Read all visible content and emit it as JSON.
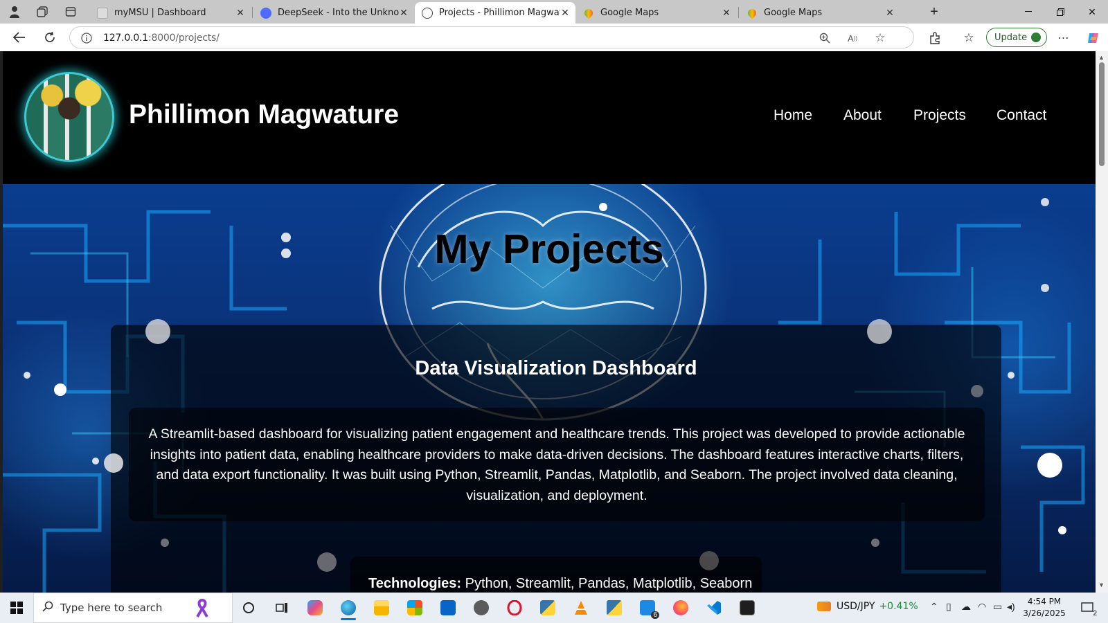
{
  "browser": {
    "tabs": [
      {
        "title": "myMSU | Dashboard",
        "favicon_color": "#d8d8d8",
        "active": false
      },
      {
        "title": "DeepSeek - Into the Unknown",
        "favicon_color": "#4d6bfe",
        "active": false
      },
      {
        "title": "Projects - Phillimon Magwature",
        "favicon_color": "#ffffff",
        "active": true
      },
      {
        "title": "Google Maps",
        "favicon_color": "#34a853",
        "active": false
      },
      {
        "title": "Google Maps",
        "favicon_color": "#34a853",
        "active": false
      }
    ],
    "url_host": "127.0.0.1",
    "url_rest": ":8000/projects/",
    "update_label": "Update"
  },
  "site": {
    "name": "Phillimon Magwature",
    "nav": [
      "Home",
      "About",
      "Projects",
      "Contact"
    ]
  },
  "hero": {
    "title": "My Projects"
  },
  "project": {
    "title": "Data Visualization Dashboard",
    "description": "A Streamlit-based dashboard for visualizing patient engagement and healthcare trends. This project was developed to provide actionable insights into patient data, enabling healthcare providers to make data-driven decisions. The dashboard features interactive charts, filters, and data export functionality. It was built using Python, Streamlit, Pandas, Matplotlib, and Seaborn. The project involved data cleaning, visualization, and deployment.",
    "tech_label": "Technologies:",
    "tech_value": " Python, Streamlit, Pandas, Matplotlib, Seaborn"
  },
  "taskbar": {
    "search_placeholder": "Type here to search",
    "ticker_symbol": "USD/JPY",
    "ticker_change": "+0.41%",
    "time": "4:54 PM",
    "date": "3/26/2025",
    "notification_count": "2",
    "app_badge": "6"
  },
  "colors": {
    "accent": "#0078d4",
    "hero_blue": "#0b2d6e",
    "avatar_glow": "#3fc8cf"
  }
}
